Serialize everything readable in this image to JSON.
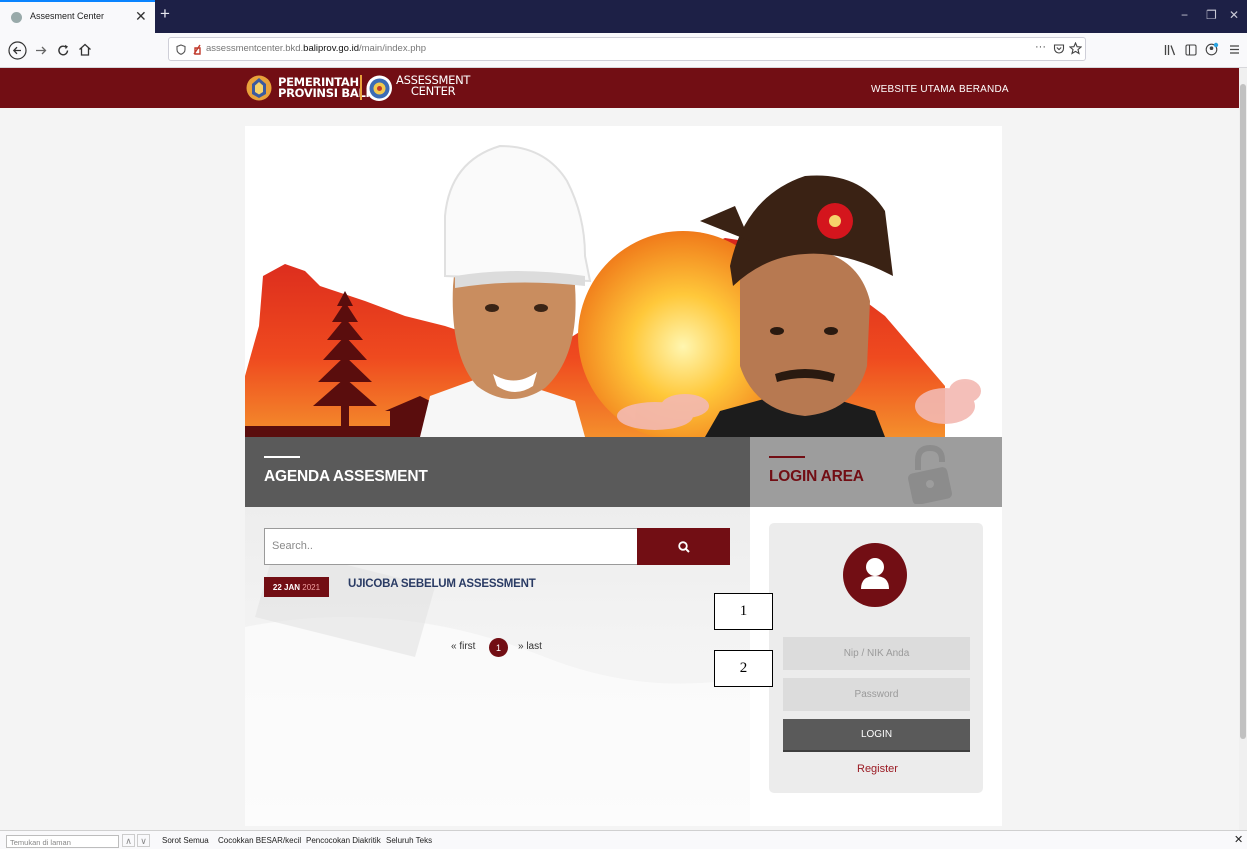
{
  "browser": {
    "tab_title": "Assesment Center",
    "tab_close": "✕",
    "new_tab": "+",
    "window_minimize": "−",
    "window_restore": "❐",
    "window_close": "✕",
    "url_domain_prefix": "assessmentcenter.bkd.",
    "url_domain_bold": "baliprov.go.id",
    "url_path": "/main/index.php",
    "url_more": "···"
  },
  "site": {
    "brand_line1": "PEMERINTAH",
    "brand_line2": "PROVINSI BALI",
    "brand2_line1": "ASSESSMENT",
    "brand2_line2": "CENTER",
    "nav": [
      "WEBSITE UTAMA",
      "BERANDA"
    ],
    "accent": "#720e14"
  },
  "agenda": {
    "title": "AGENDA ASSESMENT",
    "search_placeholder": "Search..",
    "events": [
      {
        "day_month": "22 JAN",
        "year": "2021",
        "title": "UJICOBA SEBELUM ASSESSMENT"
      }
    ],
    "pagination": {
      "first": "« first",
      "current": "1",
      "last": "» last"
    }
  },
  "login": {
    "title": "LOGIN AREA",
    "username_placeholder": "Nip / NIK Anda",
    "password_placeholder": "Password",
    "button": "LOGIN",
    "register": "Register"
  },
  "annotations": [
    "1",
    "2"
  ],
  "findbar": {
    "input_placeholder": "Temukan di laman",
    "options": [
      "Sorot Semua",
      "Cocokkan BESAR/kecil",
      "Pencocokan Diakritik",
      "Seluruh Teks"
    ],
    "close": "✕"
  }
}
